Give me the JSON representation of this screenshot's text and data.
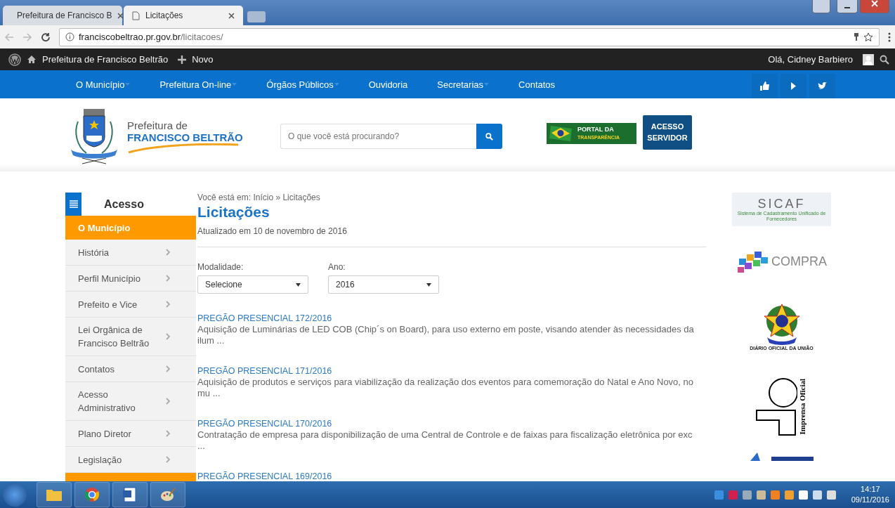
{
  "browser": {
    "tabs": [
      {
        "title": "Prefeitura de Francisco B",
        "selected": false
      },
      {
        "title": "Licitações",
        "selected": true
      }
    ],
    "url_host": "franciscobeltrao.pr.gov.br",
    "url_path": "/licitacoes/"
  },
  "admin_bar": {
    "site": "Prefeitura de Francisco Beltrão",
    "new": "Novo",
    "greeting": "Olá, Cidney Barbiero"
  },
  "nav": {
    "items": [
      {
        "label": "O Município",
        "dropdown": true
      },
      {
        "label": "Prefeitura On-line",
        "dropdown": true
      },
      {
        "label": "Órgãos Públicos",
        "dropdown": true
      },
      {
        "label": "Ouvidoria",
        "dropdown": false
      },
      {
        "label": "Secretarias",
        "dropdown": true
      },
      {
        "label": "Contatos",
        "dropdown": false
      }
    ]
  },
  "header": {
    "logo_line1": "Prefeitura de",
    "logo_line2": "FRANCISCO BELTRÃO",
    "search": {
      "placeholder": "O que você está procurando?"
    },
    "portal_line1": "PORTAL DA",
    "portal_line2": "TRANSPARÊNCIA",
    "access_button": "ACESSO SERVIDOR"
  },
  "sidebar": {
    "title": "Acesso",
    "section": "O Município",
    "items": [
      "História",
      "Perfil Município",
      "Prefeito e Vice",
      "Lei Orgânica de Francisco Beltrão",
      "Contatos",
      "Acesso Administrativo",
      "Plano Diretor",
      "Legislação"
    ]
  },
  "content": {
    "breadcrumb": "Você está em: Início » Licitações",
    "title": "Licitações",
    "updated": "Atualizado em 10 de novembro de 2016",
    "filters": [
      {
        "label": "Modalidade:",
        "value": "Selecione"
      },
      {
        "label": "Ano:",
        "value": "2016"
      }
    ],
    "results": [
      {
        "title": "PREGÃO PRESENCIAL 172/2016",
        "description": "Aquisição de Luminárias de LED COB (Chip´s on Board), para uso externo em poste, visando atender às necessidades da ilum ..."
      },
      {
        "title": "PREGÃO PRESENCIAL 171/2016",
        "description": "Aquisição de produtos e serviços para viabilização da realização dos eventos para comemoração do Natal e Ano Novo, no mu ..."
      },
      {
        "title": "PREGÃO PRESENCIAL 170/2016",
        "description": "Contratação de empresa para disponibilização de uma Central de Controle e de faixas para fiscalização eletrônica por exc ..."
      },
      {
        "title": "PREGÃO PRESENCIAL 169/2016"
      }
    ]
  },
  "partners": {
    "sicaf": "SICAF",
    "sicaf_subtitle": "Sistema de Cadastramento Unificado de Fornecedores",
    "compra": "COMPRA",
    "dou": "DIÁRIO OFICIAL DA UNIÃO",
    "imprensa": "Imprensa Oficial"
  },
  "taskbar": {
    "time": "14:17",
    "date": "09/11/2016"
  }
}
